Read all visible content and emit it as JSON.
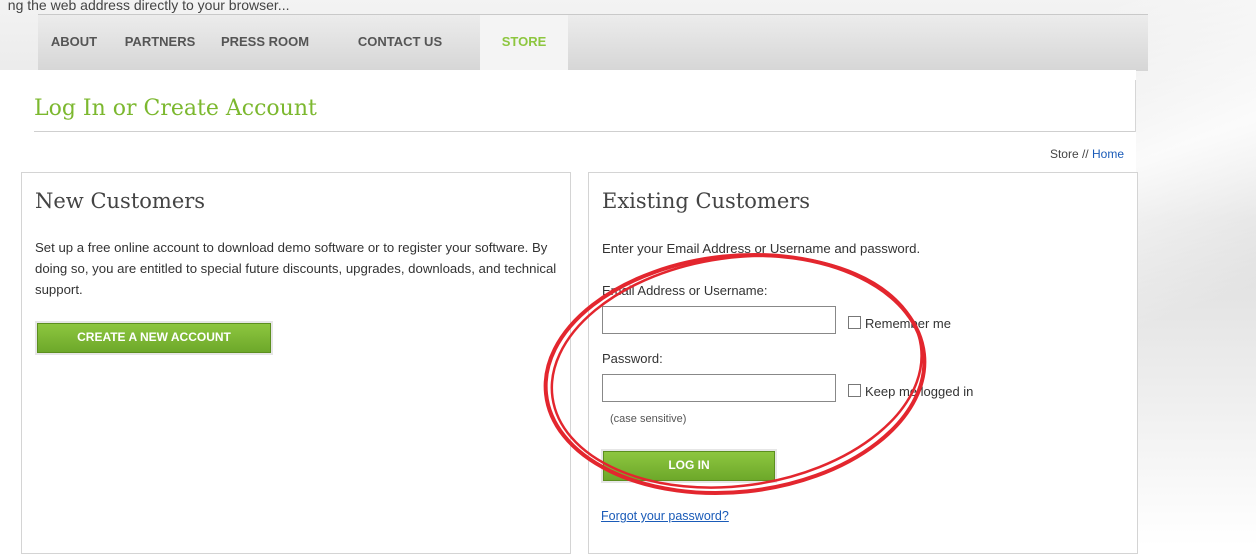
{
  "top_strip_text": "  ng the web address directly to your browser...",
  "nav": {
    "items": [
      {
        "label": "ABOUT"
      },
      {
        "label": "PARTNERS"
      },
      {
        "label": "PRESS ROOM"
      },
      {
        "label": "CONTACT US"
      },
      {
        "label": "STORE"
      }
    ],
    "active_index": 4
  },
  "page": {
    "title": "Log In or Create Account",
    "breadcrumb": {
      "store": "Store",
      "separator": "//",
      "home": "Home"
    }
  },
  "new_customers": {
    "title": "New Customers",
    "body": "Set up a free online account to download demo software or to register your software. By doing so, you are entitled to special future discounts, upgrades, downloads, and technical support.",
    "button_label": "CREATE A NEW ACCOUNT"
  },
  "existing_customers": {
    "title": "Existing Customers",
    "intro": "Enter your Email Address or Username and password.",
    "email_label": "Email Address or Username:",
    "email_value": "",
    "remember_label": "Remember me",
    "remember_checked": false,
    "password_label": "Password:",
    "password_value": "",
    "keep_logged_label": "Keep me logged in",
    "keep_logged_checked": false,
    "case_note": "(case sensitive)",
    "login_button_label": "LOG IN",
    "forgot_link": "Forgot your password?"
  },
  "colors": {
    "accent_green": "#8dc63f",
    "title_green": "#7cb82f",
    "link_blue": "#1a5bb8",
    "annotation_red": "#e3262e"
  }
}
